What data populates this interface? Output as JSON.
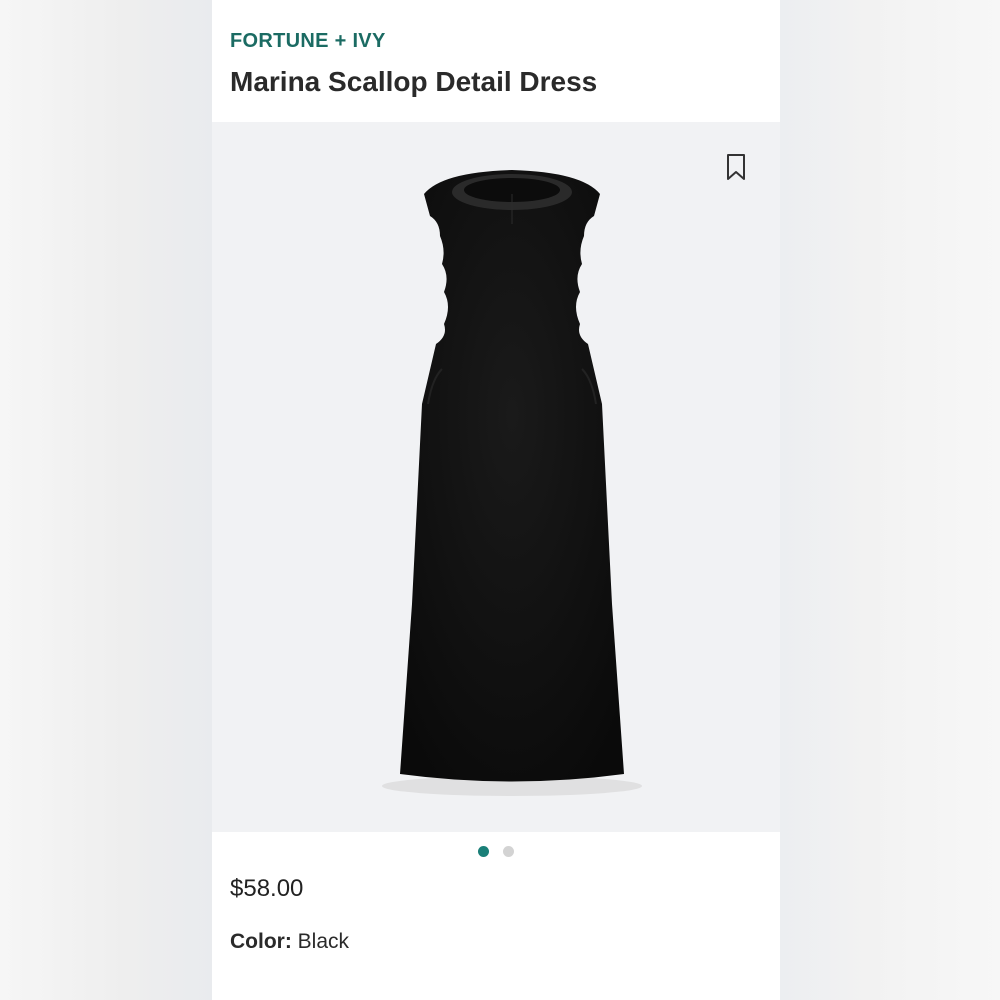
{
  "product": {
    "brand": "FORTUNE + IVY",
    "name": "Marina Scallop Detail Dress",
    "price": "$58.00",
    "color_label": "Color:",
    "color_value": "Black"
  },
  "gallery": {
    "image_count": 2,
    "active_index": 0
  },
  "icons": {
    "save": "bookmark-icon"
  },
  "colors": {
    "brand": "#1b6b63",
    "dot_active": "#1a7f78",
    "dot_inactive": "#d3d3d3",
    "image_bg": "#f1f2f4",
    "dress": "#111111"
  }
}
